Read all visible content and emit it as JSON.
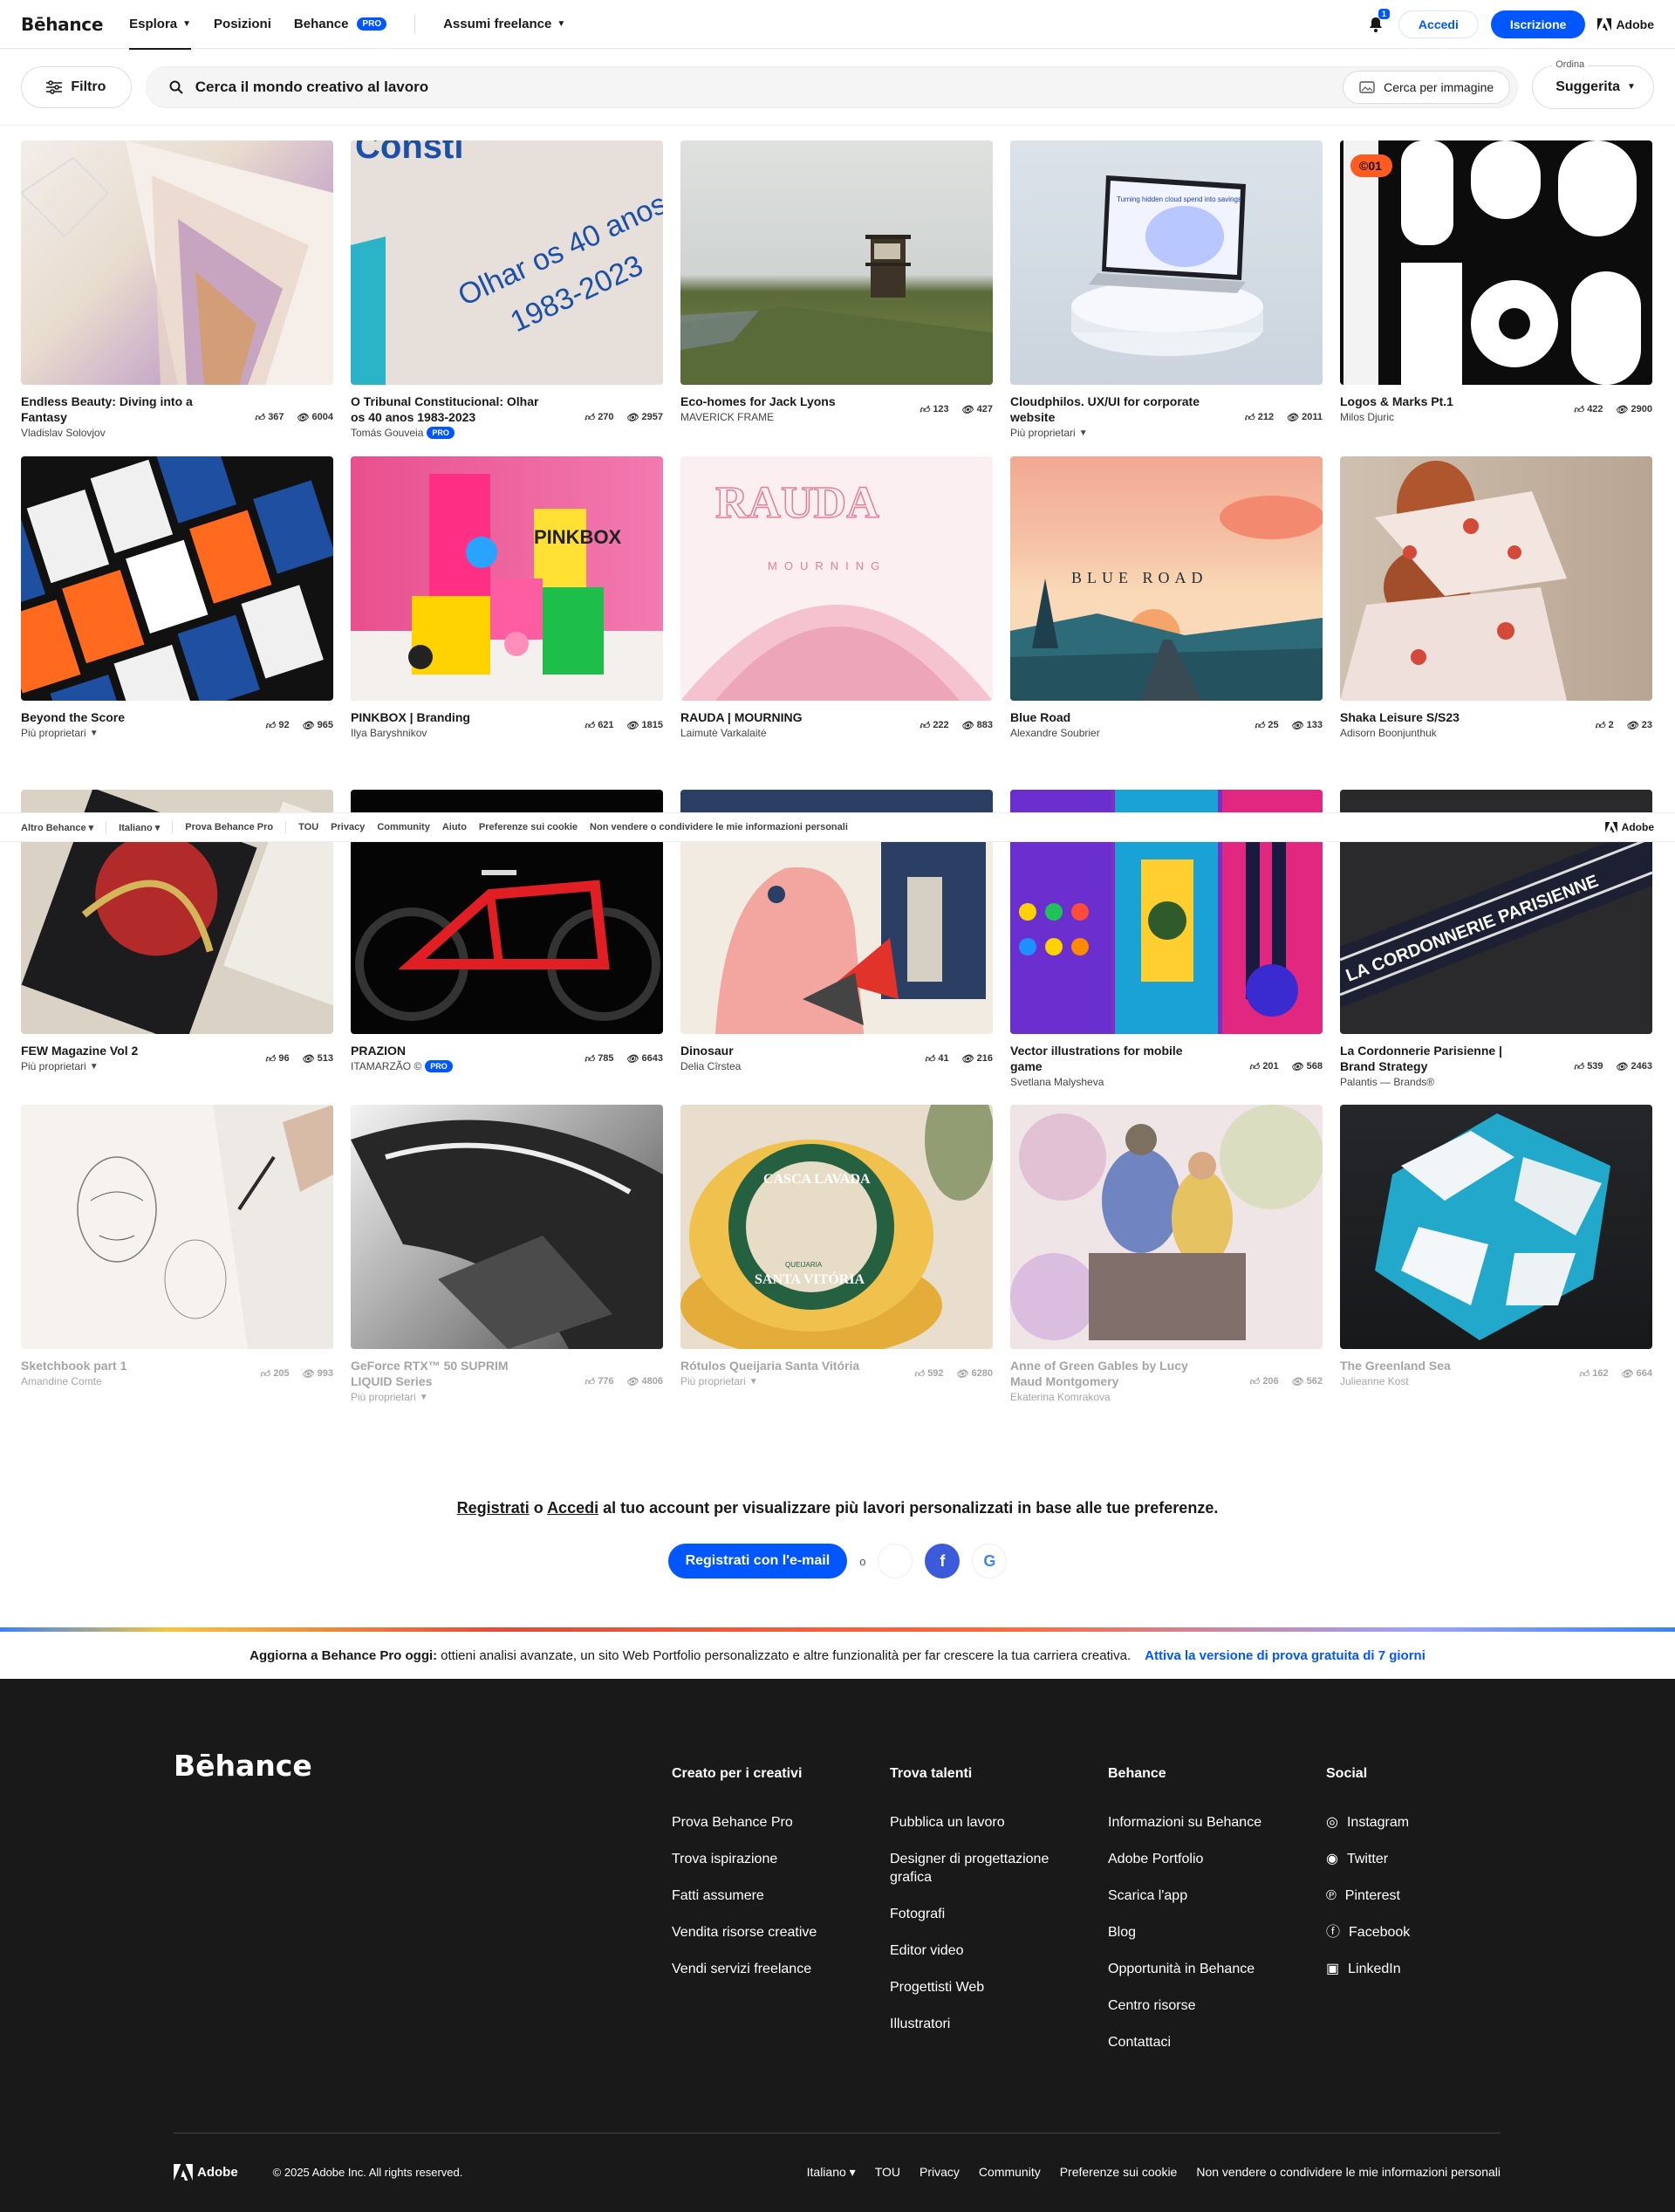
{
  "header": {
    "logo": "Bēhance",
    "nav": [
      {
        "label": "Esplora",
        "chevron": true
      },
      {
        "label": "Posizioni"
      },
      {
        "label": "Behance",
        "badge": "PRO"
      },
      {
        "label": "Assumi freelance",
        "chevron": true
      }
    ],
    "notif_count": "1",
    "login": "Accedi",
    "signup": "Iscrizione",
    "adobe": "Adobe"
  },
  "search": {
    "filter": "Filtro",
    "placeholder": "Cerca il mondo creativo al lavoro",
    "image_search": "Cerca per immagine",
    "sort_label": "Ordina",
    "sort_value": "Suggerita"
  },
  "projects": [
    {
      "title": "Endless Beauty: Diving into a Fantasy",
      "owner": "Vladislav Solovjov",
      "likes": "367",
      "views": "6004"
    },
    {
      "title": "O Tribunal Constitucional: Olhar os 40 anos 1983-2023",
      "owner": "Tomás Gouveia",
      "pro": "PRO",
      "likes": "270",
      "views": "2957"
    },
    {
      "title": "Eco-homes for Jack Lyons",
      "owner": "MAVERICK FRAME",
      "likes": "123",
      "views": "427"
    },
    {
      "title": "Cloudphilos. UX/UI for corporate website",
      "owner": "Più proprietari",
      "dropdown": true,
      "likes": "212",
      "views": "2011"
    },
    {
      "title": "Logos & Marks Pt.1",
      "owner": "Milos Djuric",
      "likes": "422",
      "views": "2900"
    },
    {
      "title": "Beyond the Score",
      "owner": "Più proprietari",
      "dropdown": true,
      "likes": "92",
      "views": "965"
    },
    {
      "title": "PINKBOX | Branding",
      "owner": "Ilya Baryshnikov",
      "likes": "621",
      "views": "1815"
    },
    {
      "title": "RAUDA | MOURNING",
      "owner": "Laimutė Varkalaitė",
      "likes": "222",
      "views": "883"
    },
    {
      "title": "Blue Road",
      "owner": "Alexandre Soubrier",
      "likes": "25",
      "views": "133"
    },
    {
      "title": "Shaka Leisure S/S23",
      "owner": "Adisorn Boonjunthuk",
      "likes": "2",
      "views": "23"
    },
    {
      "title": "FEW Magazine Vol 2",
      "owner": "Più proprietari",
      "dropdown": true,
      "likes": "96",
      "views": "513"
    },
    {
      "title": "PRAZION",
      "owner": "ITAMARZÃO ©",
      "pro": "PRO",
      "likes": "785",
      "views": "6643"
    },
    {
      "title": "Dinosaur",
      "owner": "Delia Cîrstea",
      "likes": "41",
      "views": "216"
    },
    {
      "title": "Vector illustrations for mobile game",
      "owner": "Svetlana Malysheva",
      "likes": "201",
      "views": "568"
    },
    {
      "title": "La Cordonnerie Parisienne | Brand Strategy",
      "owner": "Palantis — Brands®",
      "likes": "539",
      "views": "2463"
    },
    {
      "title": "Sketchbook part 1",
      "owner": "Amandine Comte",
      "likes": "205",
      "views": "993"
    },
    {
      "title": "GeForce RTX™ 50 SUPRIM LIQUID Series",
      "owner": "Più proprietari",
      "dropdown": true,
      "likes": "776",
      "views": "4806"
    },
    {
      "title": "Rótulos Queijaria Santa Vitória",
      "owner": "Più proprietari",
      "dropdown": true,
      "likes": "592",
      "views": "6280"
    },
    {
      "title": "Anne of Green Gables by Lucy Maud Montgomery",
      "owner": "Ekaterina Komrakova",
      "likes": "206",
      "views": "562"
    },
    {
      "title": "The Greenland Sea",
      "owner": "Julieanne Kost",
      "likes": "162",
      "views": "664"
    }
  ],
  "thumb_text": {
    "t2a": "Consti",
    "t2b": "Olhar os 40 anos",
    "t2c": "1983-2023",
    "t4": "Turning hidden cloud spend into savings",
    "t5badge": "©01",
    "t7": "PINKBOX",
    "t8a": "RAUDA",
    "t8b": "MOURNING",
    "t9": "BLUE ROAD",
    "t15": "LA CORDONNERIE PARISIENNE",
    "t18a": "CASCA LAVADA",
    "t18b": "SANTA VITÓRIA",
    "t18c": "QUEIJARIA"
  },
  "sticky_footer": {
    "links": [
      "Altro Behance",
      "Italiano",
      "Prova Behance Pro",
      "TOU",
      "Privacy",
      "Community",
      "Aiuto",
      "Preferenze sui cookie",
      "Non vendere o condividere le mie informazioni personali"
    ],
    "adobe": "Adobe"
  },
  "cta": {
    "register": "Registrati",
    "or": "o",
    "login": "Accedi",
    "rest": "al tuo account per visualizzare più lavori personalizzati in base alle tue preferenze.",
    "email_btn": "Registrati con l'e-mail",
    "or2": "o"
  },
  "promo": {
    "bold": "Aggiorna a Behance Pro oggi:",
    "text": "ottieni analisi avanzate, un sito Web Portfolio personalizzato e altre funzionalità per far crescere la tua carriera creativa.",
    "link": "Attiva la versione di prova gratuita di 7 giorni"
  },
  "footer": {
    "logo": "Bēhance",
    "cols": [
      {
        "title": "Creato per i creativi",
        "links": [
          "Prova Behance Pro",
          "Trova ispirazione",
          "Fatti assumere",
          "Vendita risorse creative",
          "Vendi servizi freelance"
        ]
      },
      {
        "title": "Trova talenti",
        "links": [
          "Pubblica un lavoro",
          "Designer di progettazione grafica",
          "Fotografi",
          "Editor video",
          "Progettisti Web",
          "Illustratori"
        ]
      },
      {
        "title": "Behance",
        "links": [
          "Informazioni su Behance",
          "Adobe Portfolio",
          "Scarica l'app",
          "Blog",
          "Opportunità in Behance",
          "Centro risorse",
          "Contattaci"
        ]
      },
      {
        "title": "Social",
        "links": [
          "Instagram",
          "Twitter",
          "Pinterest",
          "Facebook",
          "LinkedIn"
        ]
      }
    ],
    "adobe": "Adobe",
    "copyright": "© 2025 Adobe Inc. All rights reserved.",
    "bottom_links": [
      "Italiano",
      "TOU",
      "Privacy",
      "Community",
      "Preferenze sui cookie",
      "Non vendere o condividere le mie informazioni personali"
    ]
  }
}
